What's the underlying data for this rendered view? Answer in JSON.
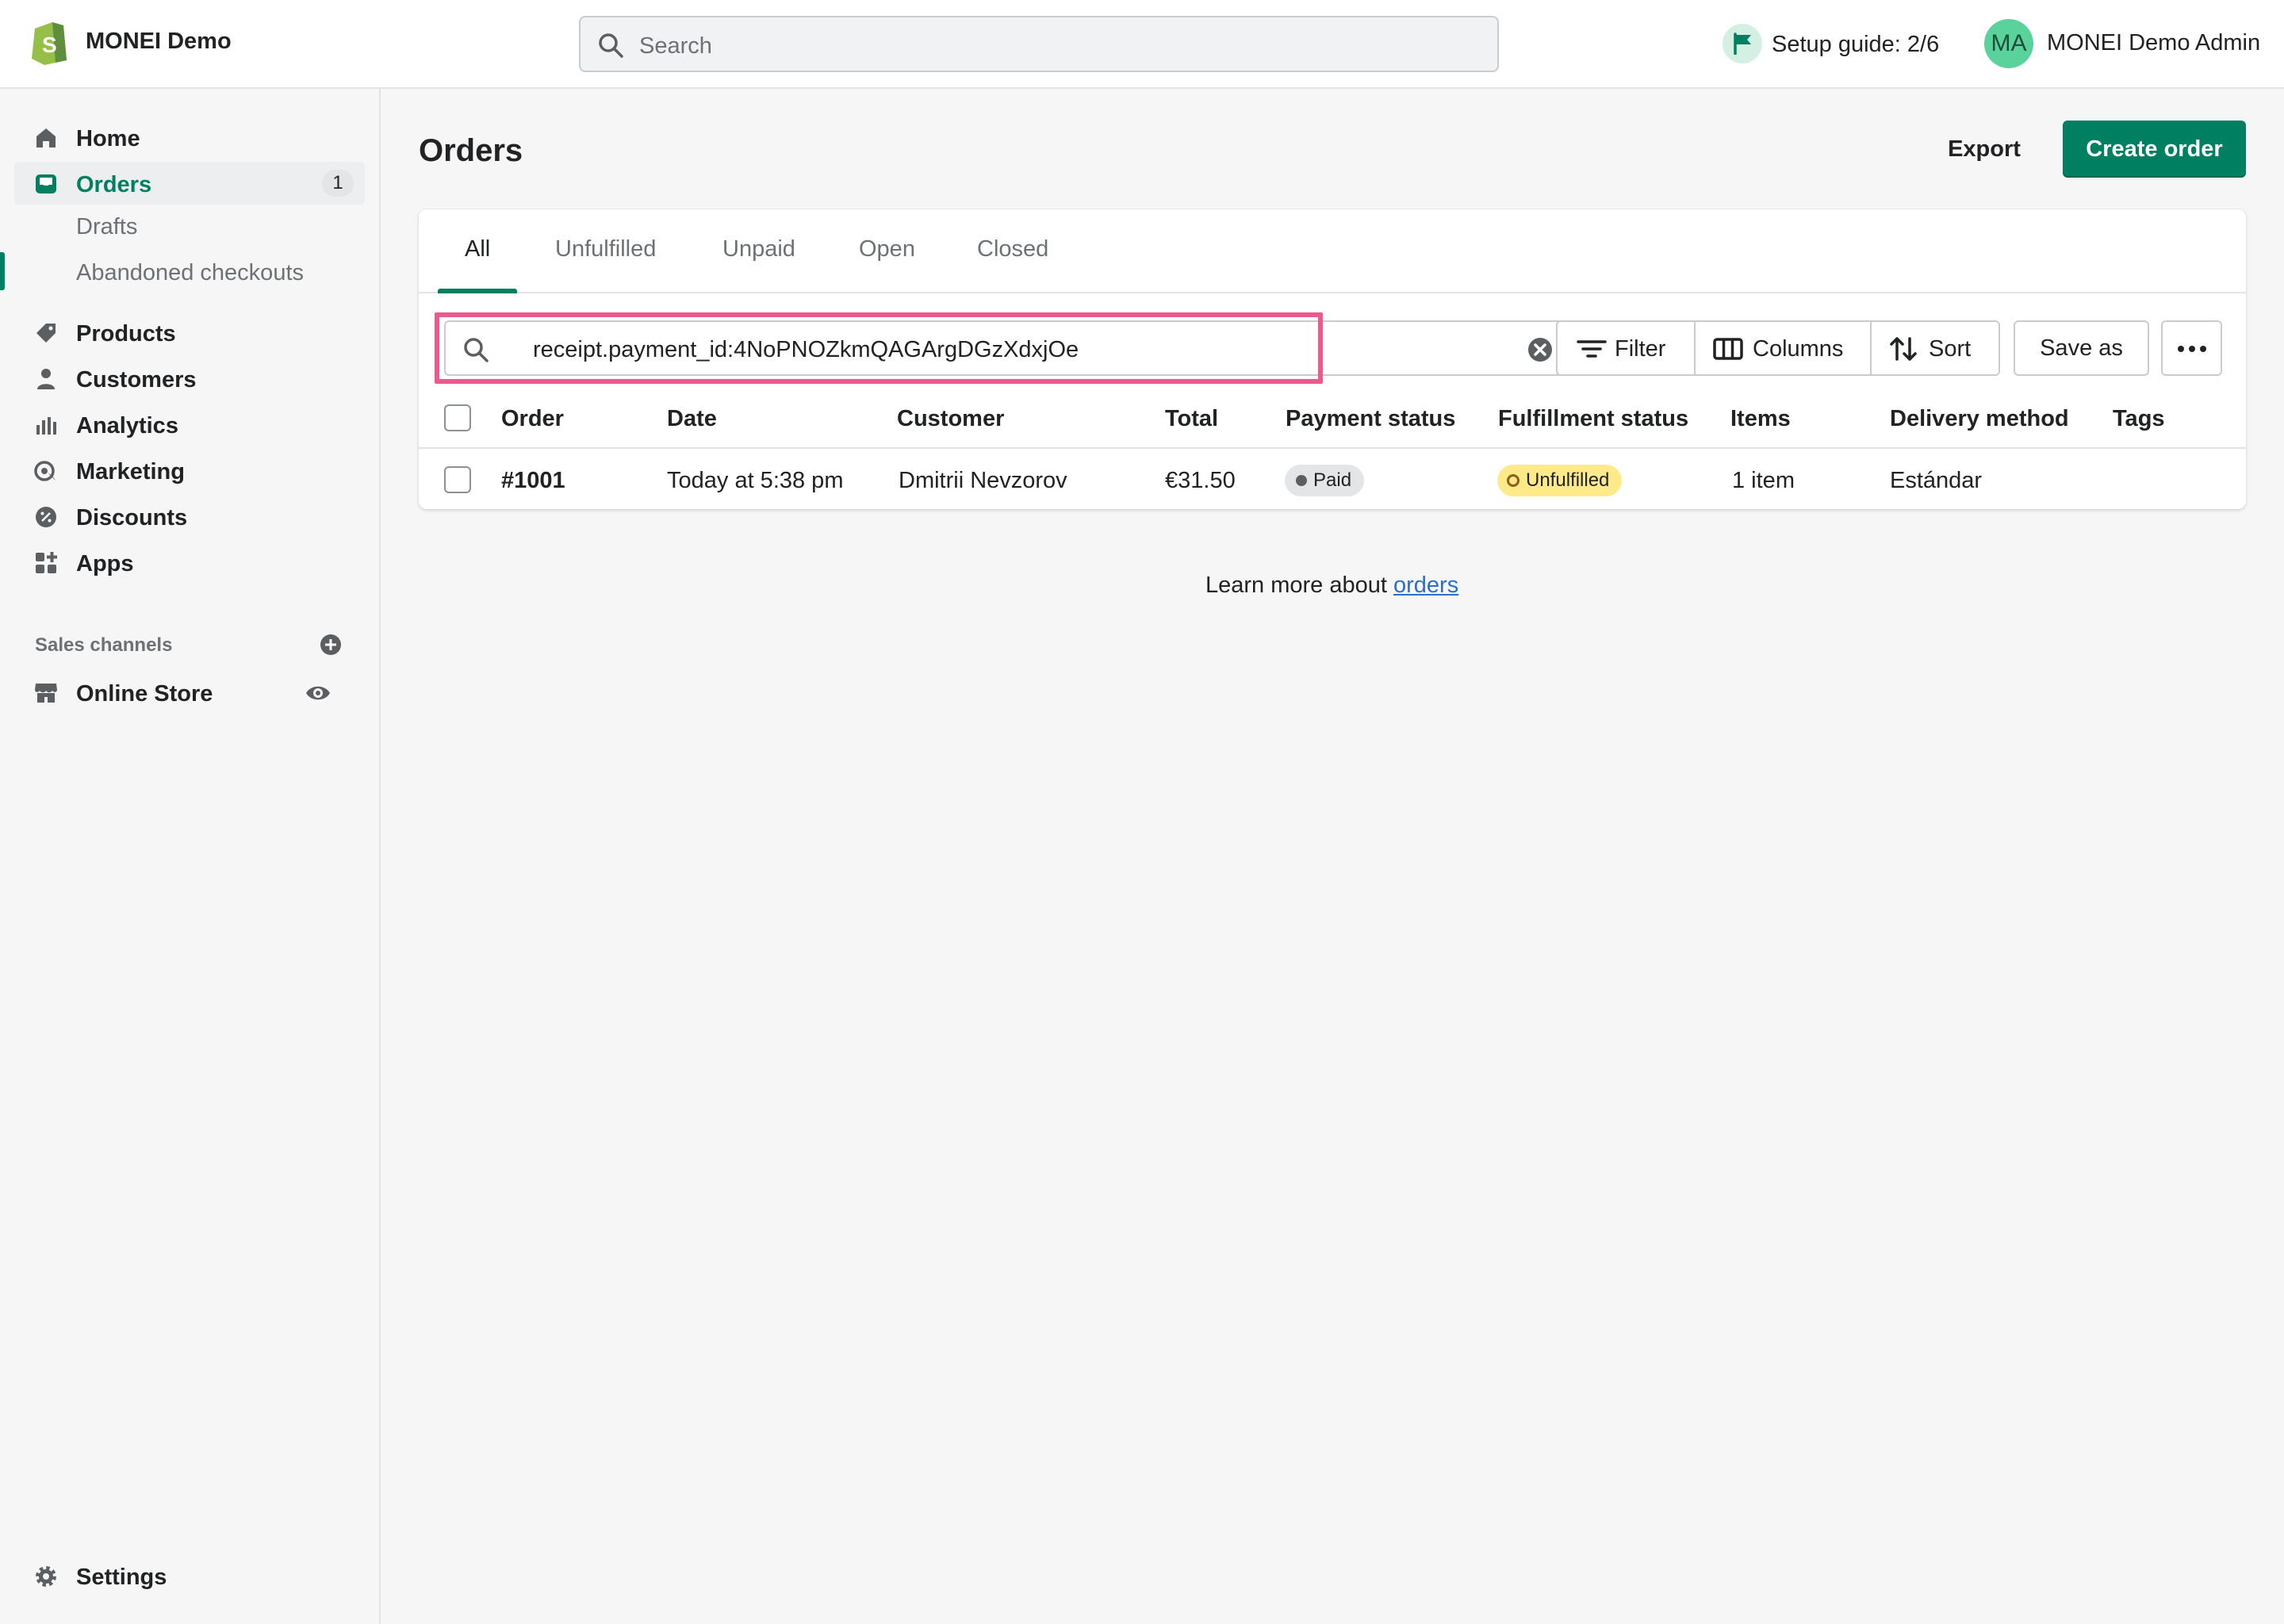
{
  "topbar": {
    "store_name": "MONEI Demo",
    "search_placeholder": "Search",
    "setup_guide": "Setup guide: 2/6",
    "avatar_initials": "MA",
    "admin_name": "MONEI Demo Admin"
  },
  "sidebar": {
    "items": [
      {
        "label": "Home",
        "icon": "home-icon"
      },
      {
        "label": "Orders",
        "icon": "orders-icon",
        "badge": "1",
        "active": true
      },
      {
        "label": "Products",
        "icon": "tag-icon"
      },
      {
        "label": "Customers",
        "icon": "person-icon"
      },
      {
        "label": "Analytics",
        "icon": "analytics-icon"
      },
      {
        "label": "Marketing",
        "icon": "marketing-icon"
      },
      {
        "label": "Discounts",
        "icon": "discount-icon"
      },
      {
        "label": "Apps",
        "icon": "apps-icon"
      }
    ],
    "orders_sub": [
      "Drafts",
      "Abandoned checkouts"
    ],
    "sales_channels_title": "Sales channels",
    "online_store": "Online Store",
    "settings": "Settings"
  },
  "main": {
    "title": "Orders",
    "export_label": "Export",
    "create_label": "Create order",
    "tabs": [
      "All",
      "Unfulfilled",
      "Unpaid",
      "Open",
      "Closed"
    ],
    "active_tab": "All",
    "query": "receipt.payment_id:4NoPNOZkmQAGArgDGzXdxjOe",
    "filter_label": "Filter",
    "columns_label": "Columns",
    "sort_label": "Sort",
    "save_label": "Save as",
    "columns": [
      "Order",
      "Date",
      "Customer",
      "Total",
      "Payment status",
      "Fulfillment status",
      "Items",
      "Delivery method",
      "Tags"
    ],
    "rows": [
      {
        "order": "#1001",
        "date": "Today at 5:38 pm",
        "customer": "Dmitrii Nevzorov",
        "total": "€31.50",
        "payment_status": "Paid",
        "fulfillment_status": "Unfulfilled",
        "items": "1 item",
        "delivery_method": "Estándar",
        "tags": ""
      }
    ],
    "learn_prefix": "Learn more about",
    "learn_link": "orders"
  },
  "colors": {
    "brand": "#008060",
    "highlight": "#ea5a8c",
    "unfulfilled_badge": "#ffea8a",
    "link": "#2c6ecb"
  }
}
